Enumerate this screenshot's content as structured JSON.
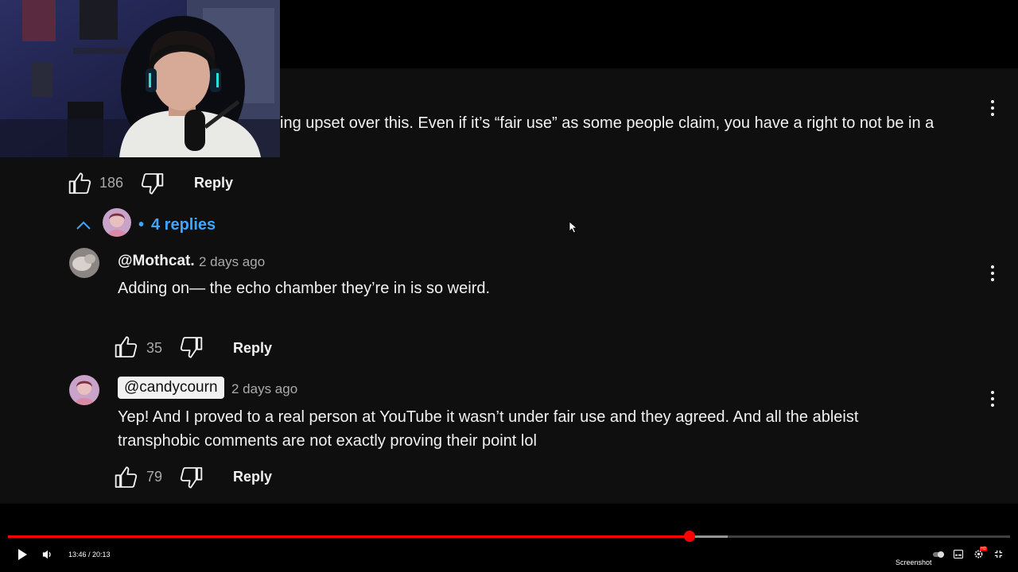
{
  "first_comment": {
    "text": "ing upset over this. Even if it’s “fair use” as some people claim, you have a right to not be in a",
    "likes": "186",
    "reply_label": "Reply"
  },
  "replies_toggle": {
    "separator": "•",
    "label": "4 replies"
  },
  "replies": [
    {
      "author": "@Mothcat.",
      "time": "2 days ago",
      "text": "Adding on— the echo chamber they’re in is so weird.",
      "likes": "35",
      "reply_label": "Reply"
    },
    {
      "author": "@candycourn",
      "time": "2 days ago",
      "text_line1": "Yep! And I proved to a real person at YouTube it wasn’t under fair use and they agreed. And all the ableist",
      "text_line2": "transphobic comments are not exactly proving their point lol",
      "likes": "79",
      "reply_label": "Reply"
    }
  ],
  "player": {
    "time_display": "13:46 / 20:13",
    "progress_fraction": 0.68,
    "buffered_fraction": 0.718,
    "screenshot_label": "Screenshot",
    "quality_badge": "HD",
    "accent_color": "#ff0000"
  },
  "colors": {
    "link": "#3ea6ff",
    "background": "#0f0f0f"
  }
}
